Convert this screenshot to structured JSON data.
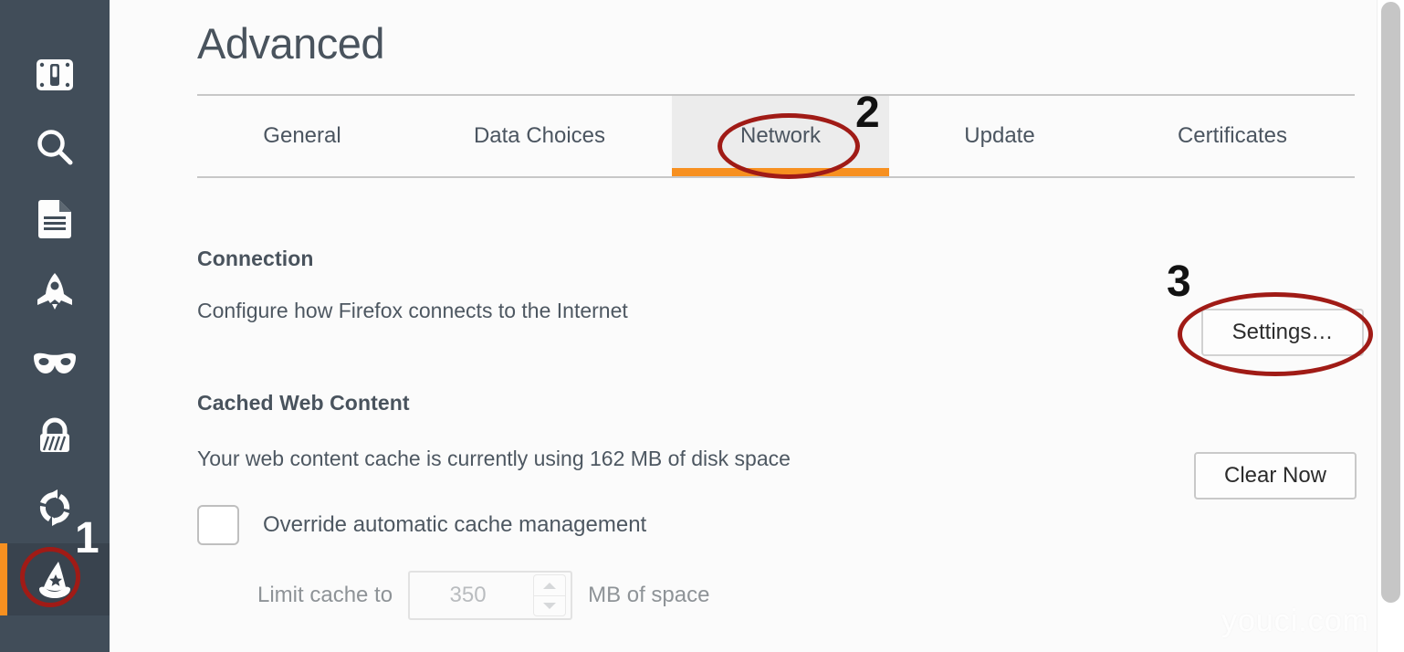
{
  "window": {
    "page_title": "Advanced",
    "watermark": "youci.com"
  },
  "sidebar": {
    "items": [
      {
        "icon": "content-blocking-icon",
        "label": "Content Blocking",
        "active": false
      },
      {
        "icon": "search-icon",
        "label": "Search",
        "active": false
      },
      {
        "icon": "document-icon",
        "label": "Content",
        "active": false
      },
      {
        "icon": "rocket-icon",
        "label": "Applications",
        "active": false
      },
      {
        "icon": "mask-icon",
        "label": "Privacy",
        "active": false
      },
      {
        "icon": "lock-icon",
        "label": "Security",
        "active": false
      },
      {
        "icon": "sync-icon",
        "label": "Sync",
        "active": false
      },
      {
        "icon": "wizard-hat-icon",
        "label": "Advanced",
        "active": true
      }
    ]
  },
  "tabs": [
    {
      "label": "General",
      "active": false
    },
    {
      "label": "Data Choices",
      "active": false
    },
    {
      "label": "Network",
      "active": true
    },
    {
      "label": "Update",
      "active": false
    },
    {
      "label": "Certificates",
      "active": false
    }
  ],
  "connection": {
    "heading": "Connection",
    "description": "Configure how Firefox connects to the Internet",
    "settings_button": "Settings…"
  },
  "cache": {
    "heading": "Cached Web Content",
    "description": "Your web content cache is currently using 162 MB of disk space",
    "clear_button": "Clear Now",
    "override_label": "Override automatic cache management",
    "override_checked": false,
    "limit_prefix": "Limit cache to",
    "limit_value": "350",
    "limit_suffix": "MB of space"
  },
  "annotations": [
    {
      "id": "1",
      "number": "1",
      "target": "sidebar-item-advanced"
    },
    {
      "id": "2",
      "number": "2",
      "target": "tab-network"
    },
    {
      "id": "3",
      "number": "3",
      "target": "settings-button"
    }
  ],
  "colors": {
    "sidebar_bg": "#414d59",
    "sidebar_active_bg": "#39434e",
    "accent_orange": "#f79020",
    "annotation_red": "#a01b16",
    "text_primary": "#49535d",
    "tab_active_bg": "#ececec"
  }
}
